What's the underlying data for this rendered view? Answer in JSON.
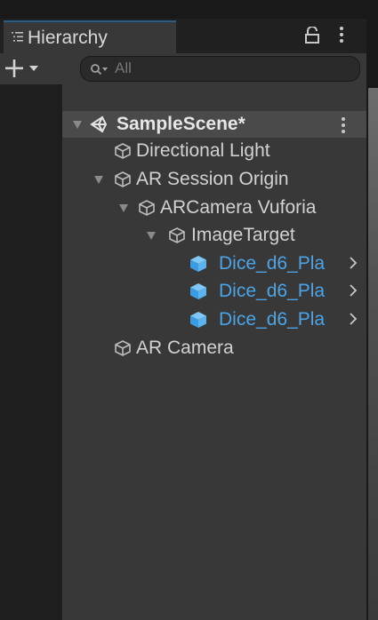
{
  "hierarchy": {
    "tab_label": "Hierarchy",
    "search_placeholder": "All",
    "scene_name": "SampleScene*",
    "items": [
      {
        "label": "Directional Light"
      },
      {
        "label": "AR Session Origin"
      },
      {
        "label": "ARCamera Vuforia"
      },
      {
        "label": "ImageTarget"
      },
      {
        "label": "Dice_d6_Pla"
      },
      {
        "label": "Dice_d6_Pla"
      },
      {
        "label": "Dice_d6_Pla"
      },
      {
        "label": "AR Camera"
      }
    ]
  },
  "colors": {
    "panel_bg": "#383838",
    "selected_row": "#4a4a4a",
    "prefab_blue": "#4ba4e8",
    "tab_accent": "#2c5d87"
  },
  "icons": {
    "gameobject": "cube-outline-icon",
    "prefab": "prefab-cube-icon",
    "scene": "unity-scene-icon"
  }
}
